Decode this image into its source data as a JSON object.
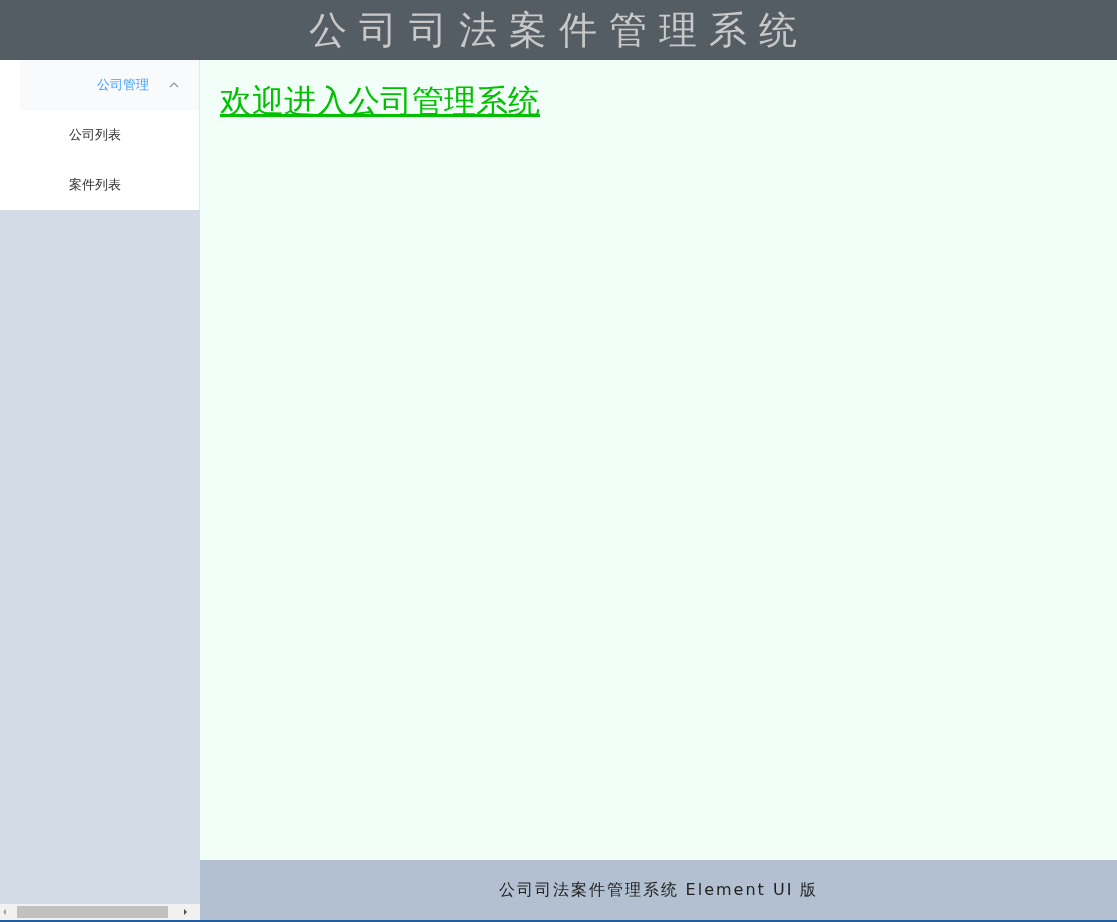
{
  "header": {
    "title": "公司司法案件管理系统"
  },
  "sidebar": {
    "menu": [
      {
        "label": "公司管理",
        "expanded": true,
        "children": [
          {
            "label": "公司列表",
            "selected": false
          },
          {
            "label": "案件列表",
            "selected": false
          }
        ]
      }
    ]
  },
  "main": {
    "welcome_link": "欢迎进入公司管理系统"
  },
  "footer": {
    "text": "公司司法案件管理系统 Element UI 版"
  }
}
